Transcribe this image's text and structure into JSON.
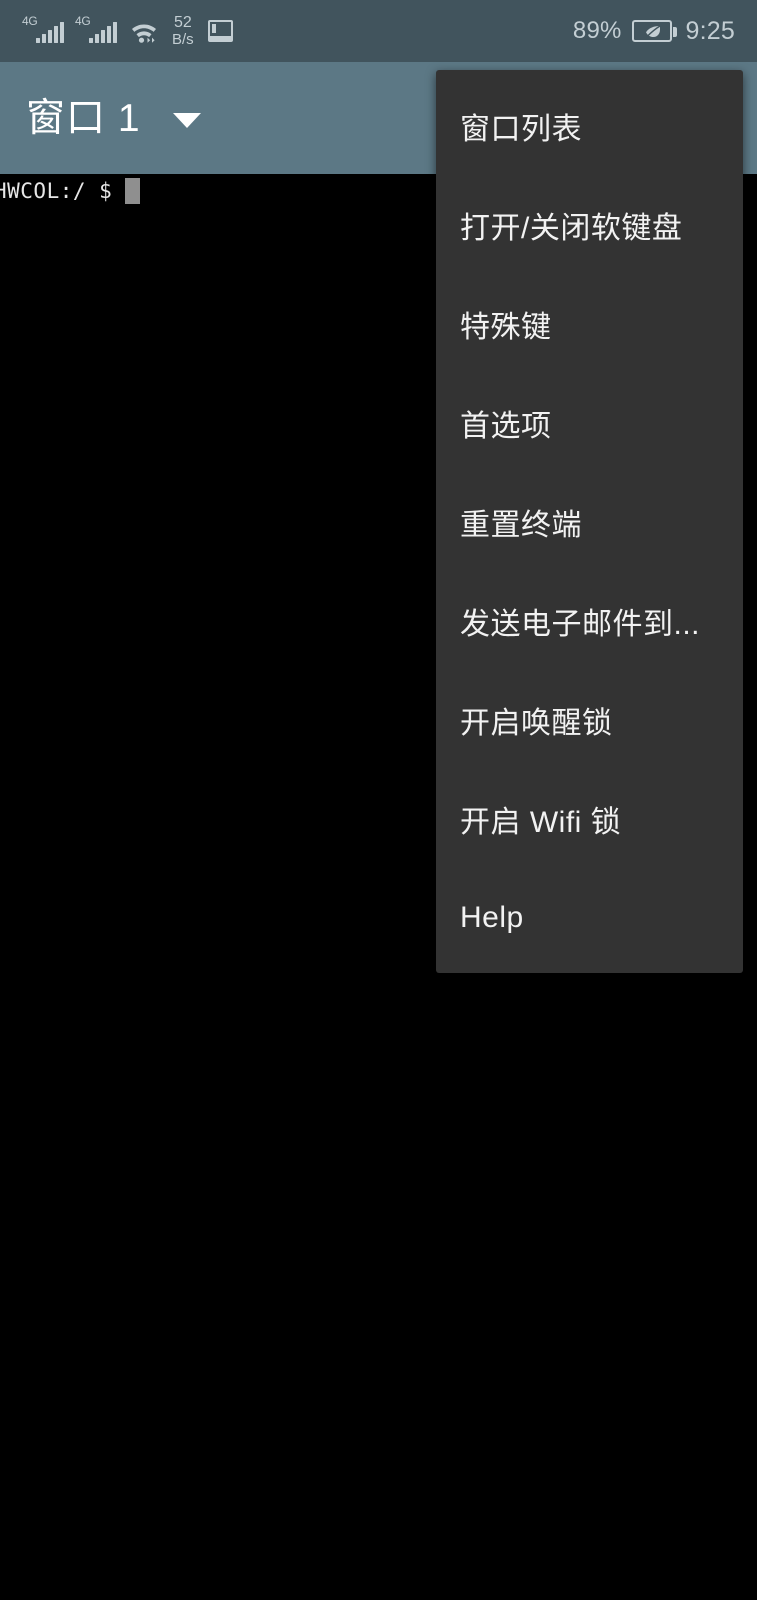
{
  "status_bar": {
    "signal_1": {
      "generation": "4G",
      "bars": 5,
      "icon": "signal-bars-icon"
    },
    "signal_2": {
      "generation": "4G",
      "bars": 5,
      "icon": "signal-bars-icon"
    },
    "wifi": {
      "icon": "wifi-icon"
    },
    "network_speed": {
      "value": "52",
      "unit": "B/s"
    },
    "notification_icon": "terminal-notification-icon",
    "battery_percent": "89%",
    "battery_icon": "battery-power-saving-leaf-icon",
    "clock": "9:25",
    "bg_color": "#41545d",
    "fg_color": "#c3ced3"
  },
  "title_bar": {
    "title": "窗口 1",
    "dropdown_icon": "chevron-down-icon",
    "bg_color": "#5c7885",
    "fg_color": "#ffffff"
  },
  "terminal": {
    "prompt": "HWCOL:/ $",
    "cursor": "block-cursor",
    "bg_color": "#000000",
    "fg_color": "#e6e6e6"
  },
  "overflow_menu": {
    "bg_color": "#333333",
    "fg_color": "#f2f2f2",
    "items": [
      {
        "label": "窗口列表"
      },
      {
        "label": "打开/关闭软键盘"
      },
      {
        "label": "特殊键"
      },
      {
        "label": "首选项"
      },
      {
        "label": "重置终端"
      },
      {
        "label": "发送电子邮件到..."
      },
      {
        "label": "开启唤醒锁"
      },
      {
        "label": "开启 Wifi 锁"
      },
      {
        "label": "Help"
      }
    ]
  }
}
